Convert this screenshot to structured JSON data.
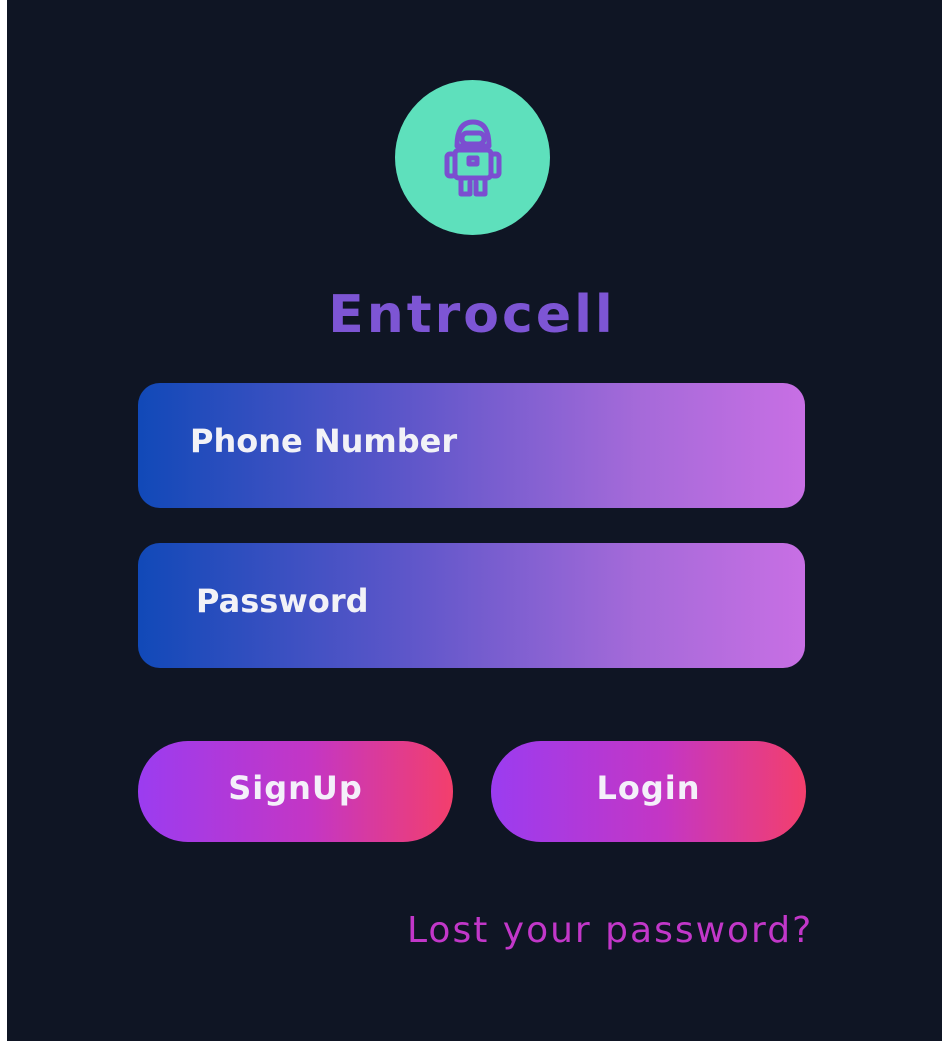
{
  "brand": {
    "name": "Entrocell",
    "logo_icon": "astronaut-icon",
    "logo_color": "#5ee0bc",
    "name_color": "#7d55d4"
  },
  "form": {
    "phone_placeholder": "Phone Number",
    "password_placeholder": "Password"
  },
  "actions": {
    "signup_label": "SignUp",
    "login_label": "Login",
    "lost_password_label": "Lost your password?"
  },
  "colors": {
    "background": "#0f1524",
    "field_gradient_start": "#1149b8",
    "field_gradient_end": "#c86fe4",
    "button_gradient_start": "#9b3cf0",
    "button_gradient_end": "#f33f6c",
    "link": "#c237c9"
  }
}
